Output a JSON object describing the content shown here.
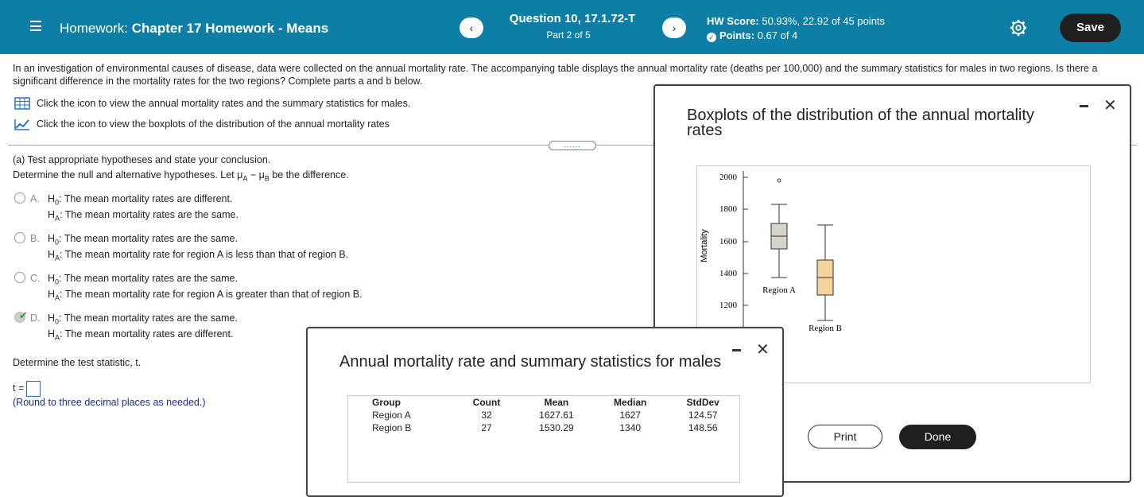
{
  "header": {
    "hw_prefix": "Homework:",
    "hw_name": "Chapter 17 Homework - Means",
    "prev": "‹",
    "next": "›",
    "question_title": "Question 10, 17.1.72-T",
    "question_part": "Part 2 of 5",
    "hw_score_label": "HW Score:",
    "hw_score_value": "50.93%, 22.92 of 45 points",
    "points_label": "Points:",
    "points_value": "0.67 of 4",
    "save_label": "Save"
  },
  "intro": "In an investigation of environmental causes of disease, data were collected on the annual mortality rate. The accompanying table displays the annual mortality rate (deaths per 100,000) and the summary statistics for males in two regions. Is there a significant difference in the mortality rates for the two regions? Complete parts a and b below.",
  "links": {
    "table_link": "Click the icon to view the annual mortality rates and the summary statistics for males.",
    "boxplot_link": "Click the icon to view the boxplots of the distribution of the annual mortality rates"
  },
  "dots": "......",
  "part_a": {
    "heading": "(a) Test appropriate hypotheses and state your conclusion.",
    "instruction_pre": "Determine the null and alternative hypotheses. Let μ",
    "instruction_post": " be the difference.",
    "options": [
      {
        "letter": "A.",
        "h0": "The mean mortality rates are different.",
        "ha": "The mean mortality rates are the same."
      },
      {
        "letter": "B.",
        "h0": "The mean mortality rates are the same.",
        "ha": "The mean mortality rate for region A is less than that of region B."
      },
      {
        "letter": "C.",
        "h0": "The mean mortality rates are the same.",
        "ha": "The mean mortality rate for region A is greater than that of region B."
      },
      {
        "letter": "D.",
        "h0": "The mean mortality rates are the same.",
        "ha": "The mean mortality rates are different."
      }
    ],
    "selected": "D.",
    "test_stat_prompt": "Determine the test statistic, t.",
    "t_label": "t =",
    "round_note": "(Round to three decimal places as needed.)"
  },
  "boxplot_modal": {
    "title": "Boxplots of the distribution of the annual mortality rates",
    "y_label": "Mortality",
    "y_ticks": [
      "2000",
      "1800",
      "1600",
      "1400",
      "1200"
    ],
    "region_a_label": "Region A",
    "region_b_label": "Region B",
    "colors": {
      "region_a": "#d6d3c8",
      "region_b": "#f6d39a"
    }
  },
  "stats_modal": {
    "title": "Annual mortality rate and summary statistics for males",
    "columns": [
      "Group",
      "Count",
      "Mean",
      "Median",
      "StdDev"
    ],
    "rows": [
      [
        "Region A",
        "32",
        "1627.61",
        "1627",
        "124.57"
      ],
      [
        "Region B",
        "27",
        "1530.29",
        "1340",
        "148.56"
      ]
    ],
    "print_label": "Print",
    "done_label": "Done"
  }
}
